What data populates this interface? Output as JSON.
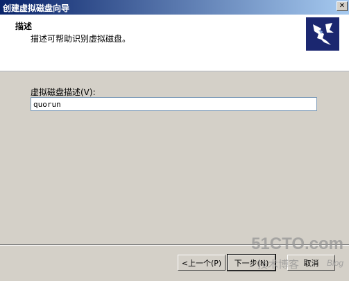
{
  "window": {
    "title": "创建虚拟磁盘向导"
  },
  "header": {
    "title": "描述",
    "subtitle": "描述可帮助识别虚拟磁盘。"
  },
  "form": {
    "description_label": "虚拟磁盘描述(V):",
    "description_value": "quorun"
  },
  "buttons": {
    "back_label": "<上一个(P)",
    "next_label": "下一步(N)",
    "cancel_label": "取消"
  },
  "watermark": {
    "line1": "51CTO.com",
    "line2": "技术博客",
    "line3": "Blog"
  },
  "colors": {
    "titlebar": "#0a246a",
    "dialog_bg": "#d4d0c8",
    "header_bg": "#ffffff",
    "logo_bg": "#1b2770"
  },
  "icons": {
    "header_logo": "wizard-disk-icon",
    "close": "close-icon"
  }
}
